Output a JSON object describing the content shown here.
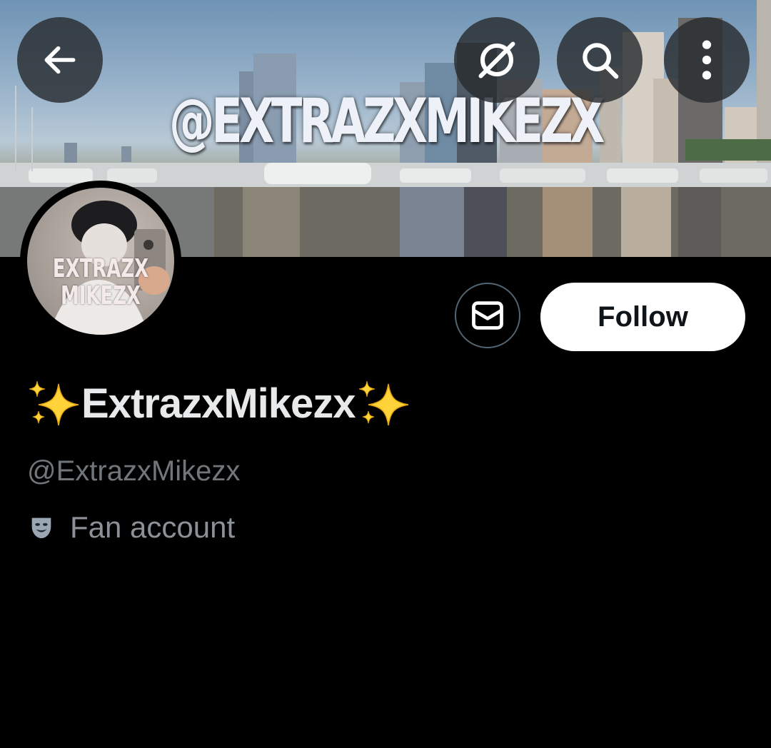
{
  "banner": {
    "overlay_text": "@EXTRAZXMIKEZX"
  },
  "topbar": {
    "back_icon": "arrow-left-icon",
    "grok_icon": "grok-icon",
    "search_icon": "search-icon",
    "more_icon": "more-vertical-icon"
  },
  "avatar": {
    "line1": "EXTRAZX",
    "line2": "MIKEZX"
  },
  "actions": {
    "message_icon": "envelope-icon",
    "follow_label": "Follow"
  },
  "profile": {
    "name_prefix_emoji": "✨",
    "display_name": "ExtrazxMikezx",
    "name_suffix_emoji": "✨",
    "handle": "@ExtrazxMikezx",
    "bio_icon": "performing-arts-icon",
    "bio": "Fan account"
  },
  "colors": {
    "background": "#000000",
    "primary_text": "#e7e9ea",
    "secondary_text": "#71767b",
    "follow_bg": "#ffffff",
    "border": "#536471"
  }
}
